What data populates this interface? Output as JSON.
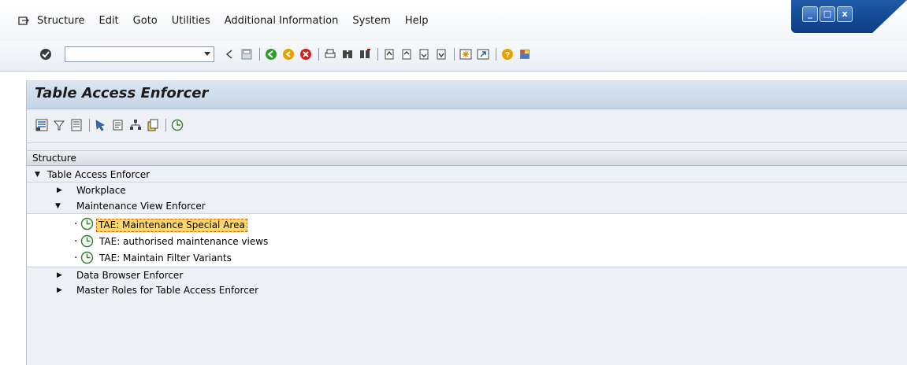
{
  "menu": {
    "items": [
      "Structure",
      "Edit",
      "Goto",
      "Utilities",
      "Additional Information",
      "System",
      "Help"
    ]
  },
  "window_controls": {
    "minimize": "_",
    "maximize": "□",
    "close": "x"
  },
  "command_field": {
    "value": ""
  },
  "page": {
    "title": "Table Access Enforcer"
  },
  "tree": {
    "header": "Structure",
    "root": "Table Access Enforcer",
    "workplace": "Workplace",
    "mve": "Maintenance View Enforcer",
    "tx1": "TAE: Maintenance Special Area",
    "tx2": "TAE: authorised maintenance views",
    "tx3": "TAE: Maintain Filter Variants",
    "dbe": "Data Browser Enforcer",
    "roles": "Master Roles for Table Access Enforcer"
  },
  "colors": {
    "selection": "#ffd86b",
    "title_bar": "#c5d5e7",
    "panel_bg": "#edf1f6"
  }
}
